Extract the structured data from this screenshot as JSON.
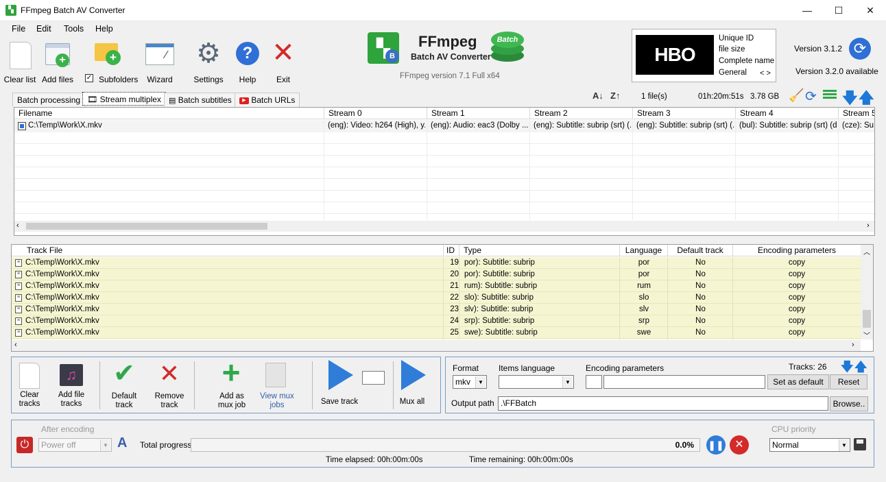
{
  "window": {
    "title": "FFmpeg Batch AV Converter",
    "minimize": "—",
    "maximize": "☐",
    "close": "✕"
  },
  "menu": [
    "File",
    "Edit",
    "Tools",
    "Help"
  ],
  "toolbar": {
    "clear_list": "Clear list",
    "add_files": "Add files",
    "subfolders": "Subfolders",
    "subfolders_checked": true,
    "wizard": "Wizard",
    "settings": "Settings",
    "help": "Help",
    "exit": "Exit"
  },
  "brand": {
    "name": "FFmpeg",
    "subtitle": "Batch AV Converter",
    "version_line": "FFmpeg version 7.1 Full  x64",
    "batch_badge": "Batch"
  },
  "mediainfo": {
    "logo": "HBO",
    "fields": [
      "Unique ID",
      "file size",
      "Complete name",
      "General"
    ],
    "nav": "< >"
  },
  "version": {
    "current": "Version 3.1.2",
    "available": "Version 3.2.0 available"
  },
  "tabs": [
    "Batch processing",
    "Stream multiplex",
    "Batch subtitles",
    "Batch URLs"
  ],
  "active_tab": 1,
  "status": {
    "files": "1 file(s)",
    "duration": "01h:20m:51s",
    "size": "3.78 GB"
  },
  "files_grid": {
    "columns": [
      "Filename",
      "Stream 0",
      "Stream 1",
      "Stream 2",
      "Stream 3",
      "Stream 4",
      "Stream 5"
    ],
    "rows": [
      [
        "C:\\Temp\\Work\\X.mkv",
        "(eng): Video: h264 (High), y...",
        "(eng): Audio: eac3 (Dolby ...",
        "(eng): Subtitle: subrip (srt) (...",
        "(eng): Subtitle: subrip (srt) (...",
        "(bul): Subtitle: subrip (srt) (d...",
        "(cze): Sub"
      ]
    ]
  },
  "tracks_grid": {
    "columns": [
      "Track File",
      "ID",
      "Type",
      "Language",
      "Default track",
      "Encoding parameters"
    ],
    "rows": [
      [
        "C:\\Temp\\Work\\X.mkv",
        "19",
        "por): Subtitle: subrip",
        "por",
        "No",
        "copy"
      ],
      [
        "C:\\Temp\\Work\\X.mkv",
        "20",
        "por): Subtitle: subrip",
        "por",
        "No",
        "copy"
      ],
      [
        "C:\\Temp\\Work\\X.mkv",
        "21",
        "rum): Subtitle: subrip",
        "rum",
        "No",
        "copy"
      ],
      [
        "C:\\Temp\\Work\\X.mkv",
        "22",
        "slo): Subtitle: subrip",
        "slo",
        "No",
        "copy"
      ],
      [
        "C:\\Temp\\Work\\X.mkv",
        "23",
        "slv): Subtitle: subrip",
        "slv",
        "No",
        "copy"
      ],
      [
        "C:\\Temp\\Work\\X.mkv",
        "24",
        "srp): Subtitle: subrip",
        "srp",
        "No",
        "copy"
      ],
      [
        "C:\\Temp\\Work\\X.mkv",
        "25",
        "swe): Subtitle: subrip",
        "swe",
        "No",
        "copy"
      ]
    ]
  },
  "mux_buttons": {
    "clear_tracks": [
      "Clear",
      "tracks"
    ],
    "add_file_tracks": [
      "Add file",
      "tracks"
    ],
    "default_track": [
      "Default",
      "track"
    ],
    "remove_track": [
      "Remove",
      "track"
    ],
    "add_mux_job": [
      "Add as",
      "mux job"
    ],
    "view_mux_jobs": [
      "View mux",
      "jobs"
    ],
    "save_track": "Save track",
    "mux_all": "Mux all"
  },
  "mux_options": {
    "format_label": "Format",
    "format_value": "mkv",
    "items_language_label": "Items language",
    "items_language_value": "",
    "encoding_label": "Encoding parameters",
    "tracks": "Tracks: 26",
    "set_default": "Set as default",
    "reset": "Reset",
    "output_label": "Output path",
    "output_value": ".\\FFBatch",
    "browse": "Browse.."
  },
  "progress": {
    "after_label": "After encoding",
    "after_value": "Power off",
    "total_label": "Total progress",
    "percent": "0.0%",
    "fraction": 0.0,
    "elapsed": "Time elapsed: 00h:00m:00s",
    "remaining": "Time remaining: 00h:00m:00s",
    "cpu_label": "CPU priority",
    "cpu_value": "Normal"
  },
  "colors": {
    "accent_blue": "#1e78d7",
    "track_row_bg": "#f5f5d2",
    "red": "#d42a2a",
    "green": "#2ea84a"
  }
}
